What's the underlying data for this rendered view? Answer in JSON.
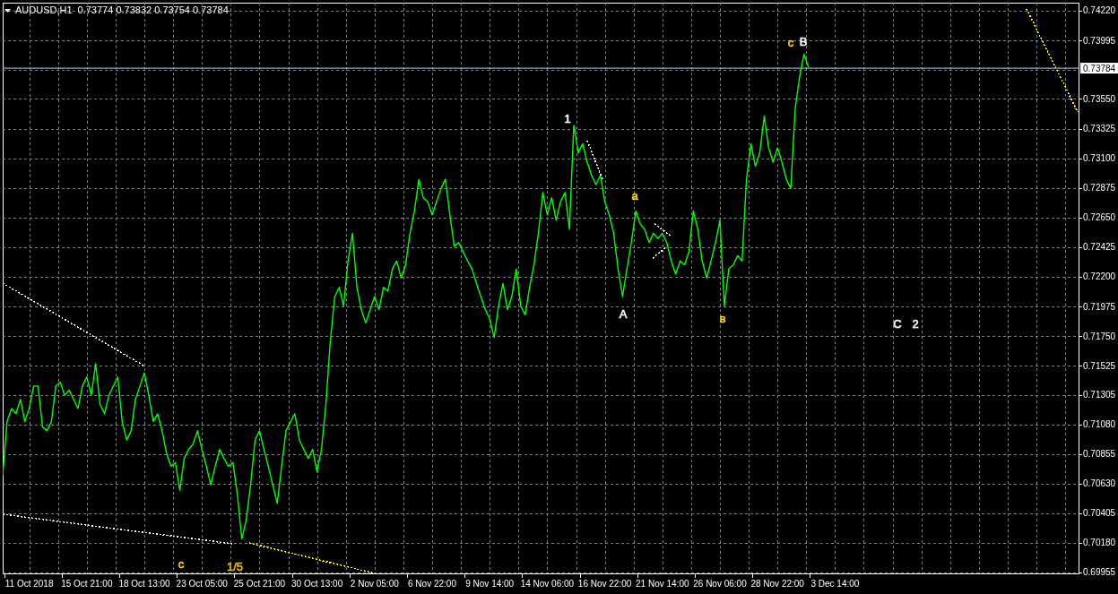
{
  "header": {
    "symbol": "AUDUSD,H1",
    "quote": "0.73774 0.73832 0.73754 0.73784"
  },
  "chart": {
    "chart_data": {
      "type": "line",
      "grid": true,
      "categories": [
        null,
        null,
        null,
        null,
        null,
        null,
        "11 Oct 2018",
        null,
        null,
        null,
        null,
        null,
        null,
        null,
        null,
        null,
        null,
        null,
        null,
        "15 Oct 21:00",
        null,
        null,
        null,
        null,
        null,
        null,
        null,
        null,
        null,
        null,
        null,
        null,
        "18 Oct 13:00",
        null,
        null,
        null,
        null,
        null,
        null,
        null,
        null,
        null,
        null,
        null,
        null,
        "23 Oct 05:00",
        null,
        null,
        null,
        null,
        null,
        null,
        null,
        null,
        null,
        null,
        null,
        null,
        "25 Oct 21:00",
        null,
        null,
        null,
        null,
        null,
        null,
        null,
        null,
        null,
        null,
        null,
        null,
        "30 Oct 13:00",
        null,
        null,
        null,
        null,
        null,
        null,
        null,
        null,
        null,
        null,
        null,
        null,
        "2 Nov 05:00",
        null,
        null,
        null,
        null,
        null,
        null,
        null,
        null,
        null,
        null,
        null,
        null,
        "6 Nov 22:00",
        null,
        null,
        null,
        null,
        null,
        null,
        null,
        null,
        null,
        null,
        null,
        null,
        "9 Nov 14:00",
        null,
        null,
        null,
        null,
        null,
        null,
        null,
        null,
        null,
        null,
        null,
        null,
        "14 Nov 06:00",
        null,
        null,
        null,
        null,
        null,
        null,
        null,
        null,
        null,
        null,
        null,
        null,
        "16 Nov 22:00",
        null,
        null,
        null,
        null,
        null,
        null,
        null,
        null,
        null,
        null,
        null,
        null,
        "21 Nov 14:00",
        null,
        null,
        null,
        null,
        null,
        null,
        null,
        null,
        null,
        null,
        null,
        null,
        "26 Nov 06:00",
        null,
        null,
        null,
        null,
        null,
        null,
        null,
        null,
        null,
        null,
        null,
        null,
        "28 Nov 22:00",
        null,
        null,
        null,
        null,
        null,
        null,
        null,
        null,
        null,
        null,
        null,
        null,
        "3 Dec 14:00",
        null,
        null,
        null,
        null,
        null,
        null,
        null,
        null,
        null,
        null,
        null,
        null,
        null,
        null,
        null,
        null,
        null,
        null,
        null,
        null,
        null,
        null,
        null,
        null,
        null,
        null,
        null,
        null,
        null,
        null,
        null,
        null,
        null,
        null,
        null,
        null,
        null,
        null,
        null,
        null,
        null,
        null,
        null,
        null,
        null,
        null,
        null,
        null,
        null,
        null,
        null,
        null,
        null,
        null,
        null
      ],
      "values": [
        0.7069,
        0.711,
        0.712,
        0.7116,
        0.7127,
        0.711,
        0.712,
        0.7137,
        0.7137,
        0.7106,
        0.7103,
        0.711,
        0.7137,
        0.714,
        0.713,
        0.7134,
        0.7127,
        0.712,
        0.7137,
        0.7144,
        0.713,
        0.7154,
        0.7123,
        0.7116,
        0.713,
        0.7137,
        0.7144,
        0.711,
        0.7096,
        0.7103,
        0.7127,
        0.7137,
        0.7147,
        0.713,
        0.711,
        0.7116,
        0.7103,
        0.7086,
        0.7076,
        0.7079,
        0.7058,
        0.7082,
        0.7089,
        0.7093,
        0.7103,
        0.7089,
        0.7076,
        0.7062,
        0.7076,
        0.7089,
        0.7082,
        0.7076,
        0.7079,
        0.7055,
        0.7021,
        0.7035,
        0.7062,
        0.7096,
        0.7103,
        0.7089,
        0.7076,
        0.7062,
        0.7048,
        0.7076,
        0.7103,
        0.711,
        0.7116,
        0.7096,
        0.7089,
        0.7082,
        0.7089,
        0.7072,
        0.7089,
        0.7123,
        0.7171,
        0.7205,
        0.7212,
        0.7198,
        0.7232,
        0.7253,
        0.7212,
        0.7195,
        0.7185,
        0.7195,
        0.7205,
        0.7195,
        0.7212,
        0.7209,
        0.7226,
        0.7232,
        0.7219,
        0.7229,
        0.7253,
        0.727,
        0.7294,
        0.728,
        0.7277,
        0.7267,
        0.7277,
        0.7287,
        0.7294,
        0.7267,
        0.7243,
        0.7246,
        0.7239,
        0.7232,
        0.7226,
        0.7215,
        0.7205,
        0.7195,
        0.7188,
        0.7174,
        0.7198,
        0.7215,
        0.7195,
        0.7205,
        0.7226,
        0.7198,
        0.7191,
        0.7212,
        0.7229,
        0.7253,
        0.7284,
        0.7267,
        0.728,
        0.7263,
        0.7277,
        0.7284,
        0.7256,
        0.7335,
        0.7314,
        0.7321,
        0.7307,
        0.7297,
        0.729,
        0.7297,
        0.7277,
        0.7267,
        0.7253,
        0.7226,
        0.7205,
        0.7226,
        0.7246,
        0.727,
        0.726,
        0.7256,
        0.7246,
        0.7253,
        0.7249,
        0.7253,
        0.7246,
        0.7232,
        0.7222,
        0.7232,
        0.7229,
        0.7239,
        0.727,
        0.7256,
        0.7232,
        0.7219,
        0.7232,
        0.7246,
        0.7263,
        0.7198,
        0.7226,
        0.7229,
        0.7236,
        0.7232,
        0.7294,
        0.7321,
        0.7304,
        0.7314,
        0.7342,
        0.7318,
        0.7307,
        0.7318,
        0.7307,
        0.7294,
        0.7287,
        0.7348,
        0.7372,
        0.7389,
        0.7379,
        null,
        null,
        null,
        null,
        null,
        null,
        null,
        null,
        null,
        null,
        null,
        null,
        null,
        null,
        null,
        null,
        null,
        null,
        null,
        null,
        null,
        null,
        null,
        null,
        null,
        null,
        null,
        null,
        null,
        null,
        null,
        null,
        null,
        null,
        null,
        null,
        null,
        null,
        null,
        null,
        null,
        null,
        null,
        null,
        null,
        null,
        null,
        null,
        null,
        null,
        null,
        null,
        null,
        null,
        null,
        null,
        null,
        null,
        null,
        null,
        null
      ],
      "ylim": [
        0.69948,
        0.74281
      ],
      "yticks": [
        {
          "value": 0.7422,
          "label": "0.74220"
        },
        {
          "value": 0.73995,
          "label": "0.73995"
        },
        {
          "value": 0.7355,
          "label": "0.73550"
        },
        {
          "value": 0.73325,
          "label": "0.73325"
        },
        {
          "value": 0.731,
          "label": "0.73100"
        },
        {
          "value": 0.72875,
          "label": "0.72875"
        },
        {
          "value": 0.7265,
          "label": "0.72650"
        },
        {
          "value": 0.72425,
          "label": "0.72425"
        },
        {
          "value": 0.722,
          "label": "0.72200"
        },
        {
          "value": 0.71975,
          "label": "0.71975"
        },
        {
          "value": 0.7175,
          "label": "0.71750"
        },
        {
          "value": 0.71525,
          "label": "0.71525"
        },
        {
          "value": 0.71305,
          "label": "0.71305"
        },
        {
          "value": 0.7108,
          "label": "0.71080"
        },
        {
          "value": 0.70855,
          "label": "0.70855"
        },
        {
          "value": 0.7063,
          "label": "0.70630"
        },
        {
          "value": 0.70405,
          "label": "0.70405"
        },
        {
          "value": 0.7018,
          "label": "0.70180"
        },
        {
          "value": 0.69955,
          "label": "0.69955"
        }
      ],
      "ref_lines": [
        {
          "axis": "y",
          "value": 0.73784,
          "label": "0.73784"
        }
      ]
    },
    "trend_lines": [
      {
        "color": "#ffffff"
      },
      {
        "color": "#ffffff"
      },
      {
        "color": "#ffff00"
      },
      {
        "color": "#ffff00"
      },
      {
        "color": "#ffffff"
      },
      {
        "color": "#ffffff"
      },
      {
        "color": "#ffffff"
      }
    ],
    "wave_labels": [
      {
        "text": "c",
        "color": "#ffd800"
      },
      {
        "text": "B",
        "color": "#ffffff"
      },
      {
        "text": "1",
        "color": "#ffffff"
      },
      {
        "text": "a",
        "color": "#ffd800"
      },
      {
        "text": "A",
        "color": "#ffffff"
      },
      {
        "text": "в",
        "color": "#ffd800"
      },
      {
        "text": "C",
        "color": "#ffffff"
      },
      {
        "text": "2",
        "color": "#ffffff"
      },
      {
        "text": "c",
        "color": "#ffd800"
      },
      {
        "text": "1/5",
        "color": "#e6b800"
      }
    ]
  }
}
